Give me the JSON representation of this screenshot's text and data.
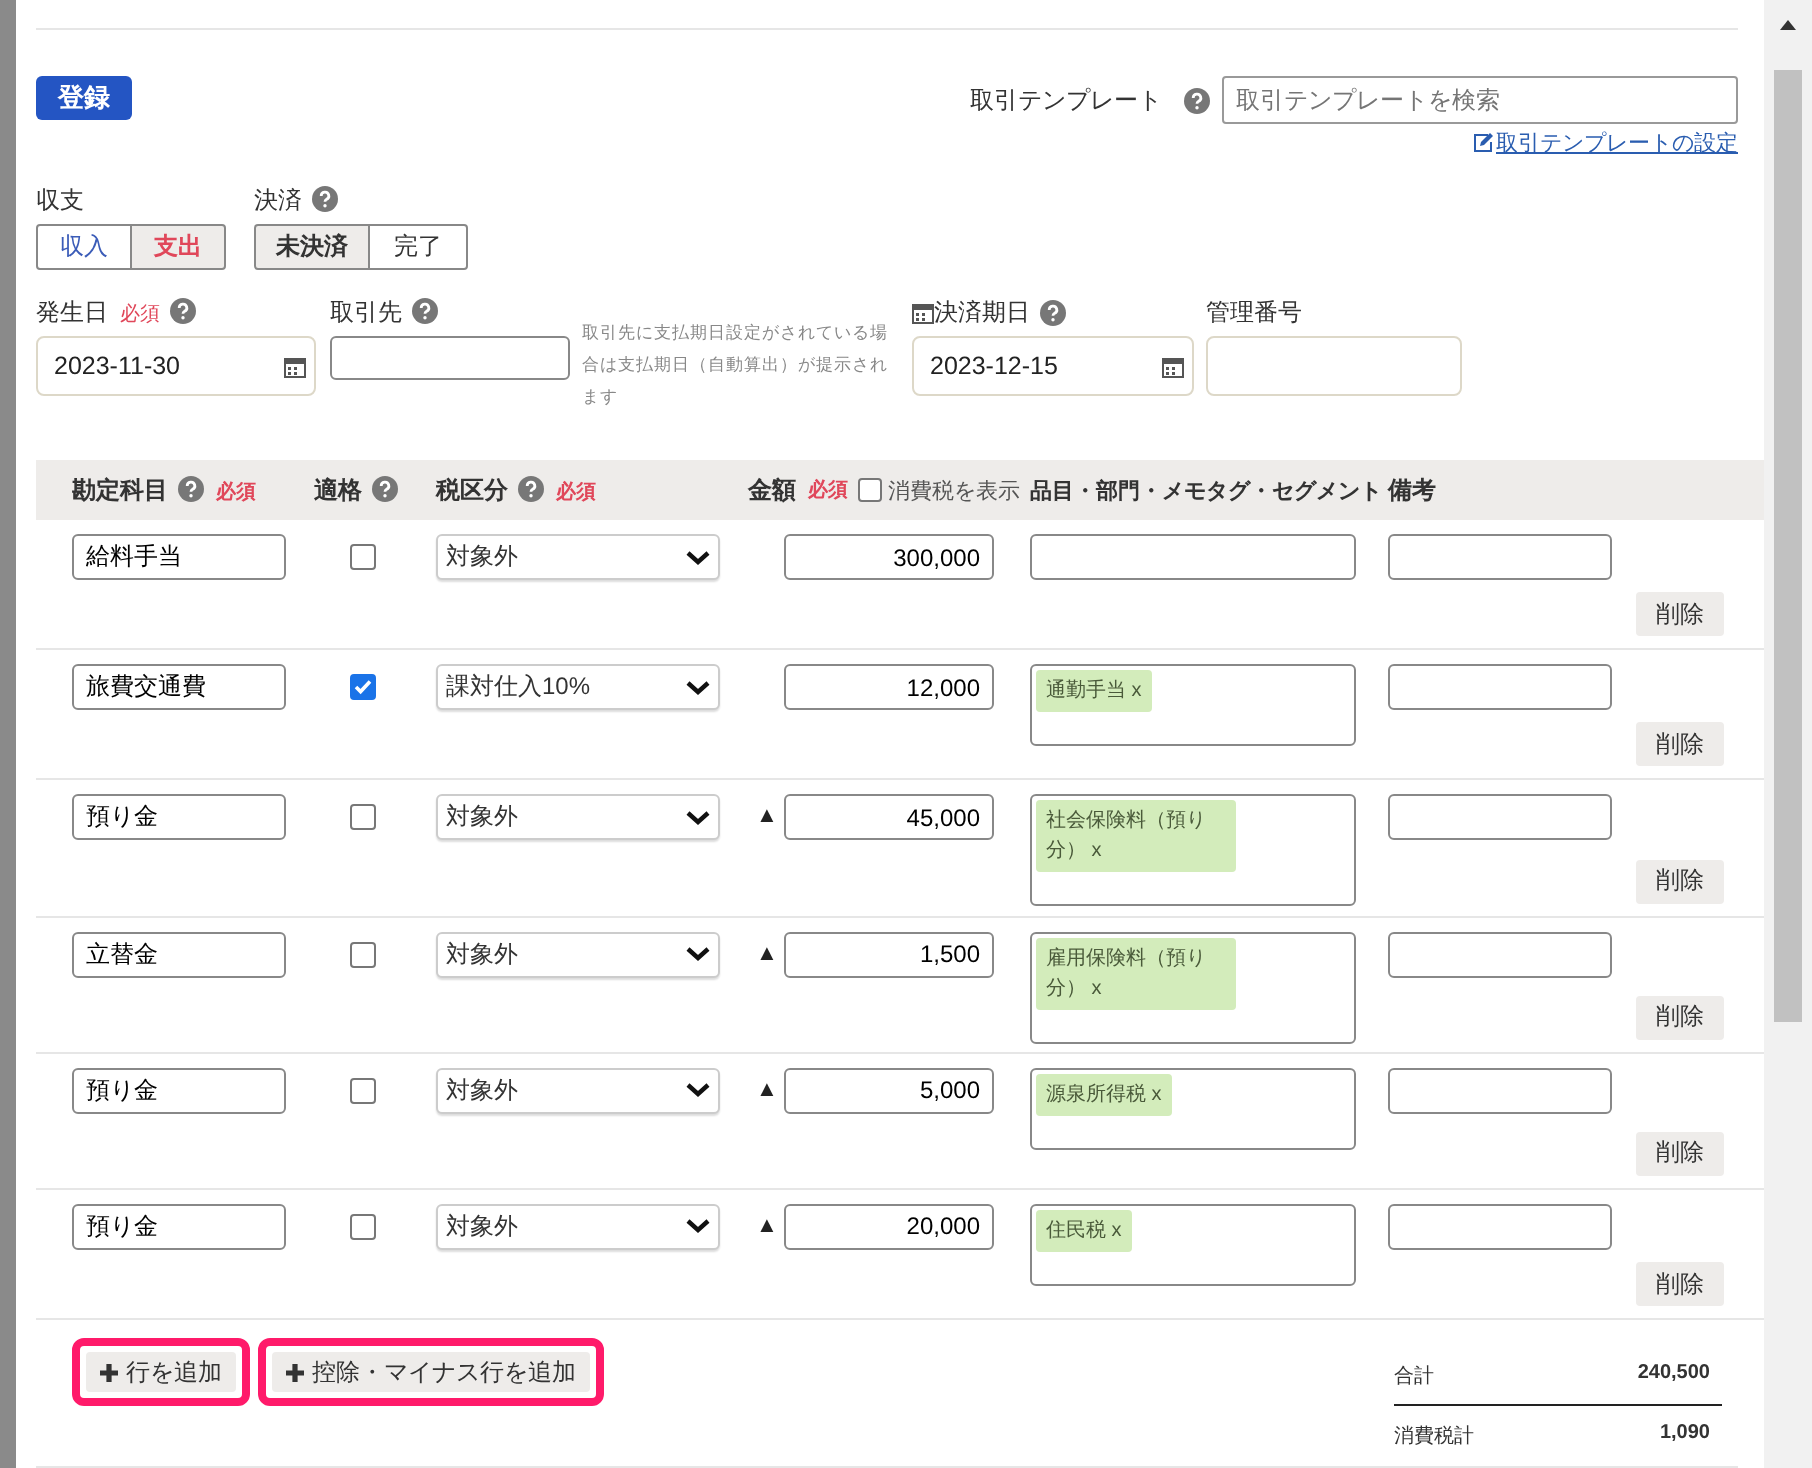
{
  "register_button": "登録",
  "template": {
    "label": "取引テンプレート",
    "placeholder": "取引テンプレートを検索",
    "settings_link": "取引テンプレートの設定"
  },
  "income_expense": {
    "label": "収支",
    "options": [
      {
        "label": "収入",
        "selected": false
      },
      {
        "label": "支出",
        "selected": true
      }
    ]
  },
  "settlement": {
    "label": "決済",
    "options": [
      {
        "label": "未決済",
        "selected": true
      },
      {
        "label": "完了",
        "selected": false
      }
    ]
  },
  "issue_date": {
    "label": "発生日",
    "required": "必須",
    "value": "2023-11-30"
  },
  "partner": {
    "label": "取引先",
    "hint": "取引先に支払期日設定がされている場合は支払期日（自動算出）が提示されます"
  },
  "due_date": {
    "label": "決済期日",
    "value": "2023-12-15"
  },
  "management_number": {
    "label": "管理番号"
  },
  "table": {
    "columns": {
      "account": "勘定科目",
      "account_required": "必須",
      "qualified": "適格",
      "tax": "税区分",
      "tax_required": "必須",
      "amount": "金額",
      "amount_required": "必須",
      "show_tax": {
        "label": "消費税を表示",
        "checked": false
      },
      "tags": "品目・部門・メモタグ・セグメント",
      "note": "備考"
    },
    "rows": [
      {
        "account": "給料手当",
        "qualified": false,
        "tax": "対象外",
        "amount": "300,000",
        "tags": [],
        "delete": "削除"
      },
      {
        "account": "旅費交通費",
        "qualified": true,
        "tax": "課対仕入10%",
        "amount": "12,000",
        "tags": [
          "通勤手当 x"
        ],
        "delete": "削除"
      },
      {
        "account": "預り金",
        "qualified": false,
        "tax": "対象外",
        "minus_mark": "▲",
        "amount": "45,000",
        "tags": [
          "社会保険料（預り分） x"
        ],
        "delete": "削除"
      },
      {
        "account": "立替金",
        "qualified": false,
        "tax": "対象外",
        "minus_mark": "▲",
        "amount": "1,500",
        "tags": [
          "雇用保険料（預り分） x"
        ],
        "delete": "削除"
      },
      {
        "account": "預り金",
        "qualified": false,
        "tax": "対象外",
        "minus_mark": "▲",
        "amount": "5,000",
        "tags": [
          "源泉所得税 x"
        ],
        "delete": "削除"
      },
      {
        "account": "預り金",
        "qualified": false,
        "tax": "対象外",
        "minus_mark": "▲",
        "amount": "20,000",
        "tags": [
          "住民税 x"
        ],
        "delete": "削除"
      }
    ]
  },
  "add_row_button": "行を追加",
  "add_minus_row_button": "控除・マイナス行を追加",
  "totals": [
    {
      "label": "合計",
      "value": "240,500"
    },
    {
      "label": "消費税計",
      "value": "1,090"
    }
  ]
}
